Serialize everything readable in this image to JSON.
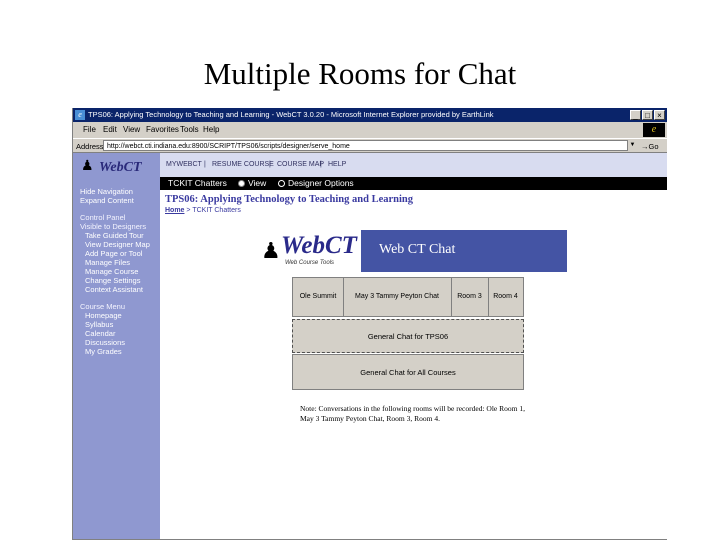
{
  "slide": {
    "title": "Multiple Rooms for Chat"
  },
  "window": {
    "title": "TPS06: Applying Technology to Teaching and Learning - WebCT 3.0.20 - Microsoft Internet Explorer provided by EarthLink",
    "buttons": [
      "_",
      "□",
      "×"
    ]
  },
  "menubar": {
    "items": [
      "File",
      "Edit",
      "View",
      "Favorites",
      "Tools",
      "Help"
    ]
  },
  "addressbar": {
    "label": "Address",
    "url": "http://webct.cti.indiana.edu:8900/SCRIPT/TPS06/scripts/designer/serve_home",
    "go_label": "→Go"
  },
  "sidebar": {
    "logo_text": "WebCT",
    "items": [
      {
        "label": "Hide Navigation",
        "type": "link"
      },
      {
        "label": "Expand Content",
        "type": "link"
      },
      {
        "label": "Control Panel",
        "type": "head"
      },
      {
        "label": "Visible to Designers",
        "type": "head"
      },
      {
        "label": "Take Guided Tour",
        "type": "sub"
      },
      {
        "label": "View Designer Map",
        "type": "sub"
      },
      {
        "label": "Add Page or Tool",
        "type": "sub"
      },
      {
        "label": "Manage Files",
        "type": "sub"
      },
      {
        "label": "Manage Course",
        "type": "sub"
      },
      {
        "label": "Change Settings",
        "type": "sub"
      },
      {
        "label": "Context Assistant",
        "type": "sub"
      },
      {
        "label": "Course Menu",
        "type": "head"
      },
      {
        "label": "Homepage",
        "type": "sub"
      },
      {
        "label": "Syllabus",
        "type": "sub"
      },
      {
        "label": "Calendar",
        "type": "sub"
      },
      {
        "label": "Discussions",
        "type": "sub"
      },
      {
        "label": "My Grades",
        "type": "sub"
      }
    ]
  },
  "topnav": {
    "items": [
      "MYWEBCT",
      "RESUME COURSE",
      "COURSE MAP",
      "HELP"
    ],
    "separator": "|"
  },
  "modebar": {
    "tab_label": "TCKIT Chatters",
    "view_label": "View",
    "designer_label": "Designer Options"
  },
  "content": {
    "course_title": "TPS06: Applying Technology to Teaching and Learning",
    "breadcrumb_home": "Home",
    "breadcrumb_sep": ">",
    "breadcrumb_current": "TCKIT Chatters",
    "banner_logo": "WebCT",
    "banner_tagline": "Web Course Tools",
    "banner_title": "Web CT Chat",
    "rooms": [
      "Ole Summit",
      "May 3 Tammy Peyton Chat",
      "Room 3",
      "Room 4"
    ],
    "course_chat": "General Chat for TPS06",
    "general_chat": "General Chat for All Courses",
    "note": "Note: Conversations in the following rooms will be recorded: Ole Room 1, May 3 Tammy Peyton Chat, Room 3, Room 4."
  },
  "colors": {
    "sidebar": "#8f98d0",
    "titlebar": "#0a246a",
    "banner": "#4454a4",
    "link": "#3a3aa0"
  }
}
